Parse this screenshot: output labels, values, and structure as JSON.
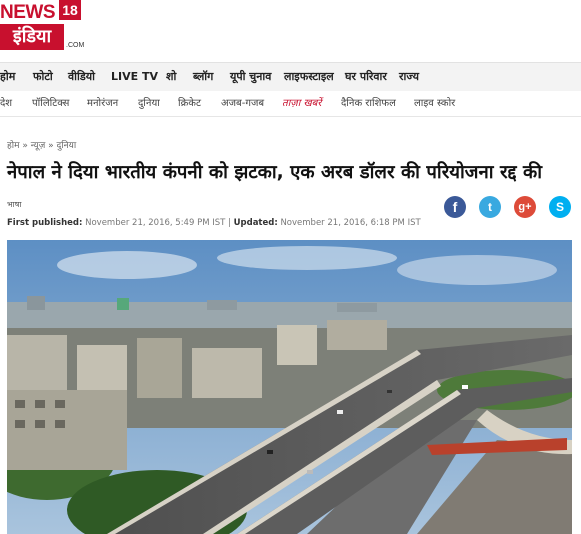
{
  "logo": {
    "brand": "NEWS",
    "number": "18",
    "language": "इंडिया",
    "suffix": ".COM"
  },
  "primary_nav": [
    "होम",
    "फोटो",
    "वीडियो",
    "LIVE TV",
    "शो",
    "ब्लॉग",
    "यूपी चुनाव",
    "लाइफस्टाइल",
    "घर परिवार",
    "राज्य"
  ],
  "secondary_nav": [
    "देश",
    "पॉलिटिक्स",
    "मनोरंजन",
    "दुनिया",
    "क्रिकेट",
    "अजब-गजब",
    "ताज़ा खबरें",
    "दैनिक राशिफल",
    "लाइव स्कोर"
  ],
  "secondary_nav_highlight": "ताज़ा खबरें",
  "article": {
    "breadcrumb": "होम » न्यूज़ » दुनिया",
    "headline": "नेपाल ने दिया भारतीय कंपनी को झटका, एक अरब डॉलर की परियोजना रद्द की",
    "author": "भाषा",
    "published_label": "First published:",
    "published_value": "November 21, 2016, 5:49 PM IST",
    "separator": "|",
    "updated_label": "Updated:",
    "updated_value": "November 21, 2016, 6:18 PM IST"
  },
  "share": {
    "facebook_glyph": "f",
    "twitter_glyph": "t",
    "googleplus_glyph": "g+",
    "skype_glyph": "S"
  },
  "photo": {
    "subject": "city flyover aerial view"
  },
  "colors": {
    "brand_red": "#c8102e",
    "facebook": "#3b5998",
    "twitter": "#39a9e0",
    "googleplus": "#dd4b39",
    "skype": "#00aff0"
  }
}
